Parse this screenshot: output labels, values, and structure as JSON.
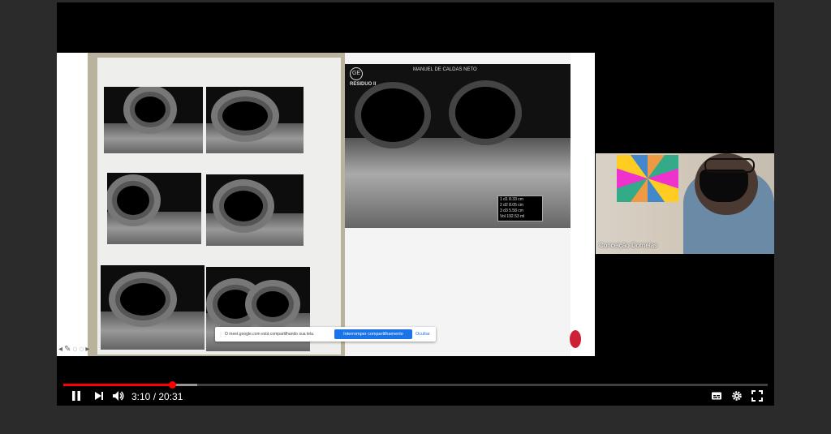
{
  "player": {
    "current_time": "3:10",
    "separator": " / ",
    "duration": "20:31",
    "played_fraction": 0.154,
    "buffered_fraction": 0.19
  },
  "slide": {
    "right_scan": {
      "logo": "GE",
      "header": "MANUEL DE CALDAS NETO",
      "label": "RESIDUO II",
      "measurements": [
        "1 d1   8.33 cm",
        "2 d2   8.05 cm",
        "3 d3   5.58 cm",
        "Vol  192.53 ml"
      ]
    }
  },
  "share_bar": {
    "message": "O meet.google.com está compartilhando sua tela.",
    "stop_label": "Interromper compartilhamento",
    "hide_label": "Ocultar"
  },
  "camera": {
    "participant_name": "Conceição Dornelas"
  },
  "colors": {
    "progress": "#ff0000",
    "share_button": "#1a73e8"
  },
  "icons": {
    "pause": "pause-icon",
    "next": "next-icon",
    "volume": "volume-icon",
    "subtitles": "subtitles-icon",
    "settings": "gear-icon",
    "fullscreen": "fullscreen-icon"
  }
}
